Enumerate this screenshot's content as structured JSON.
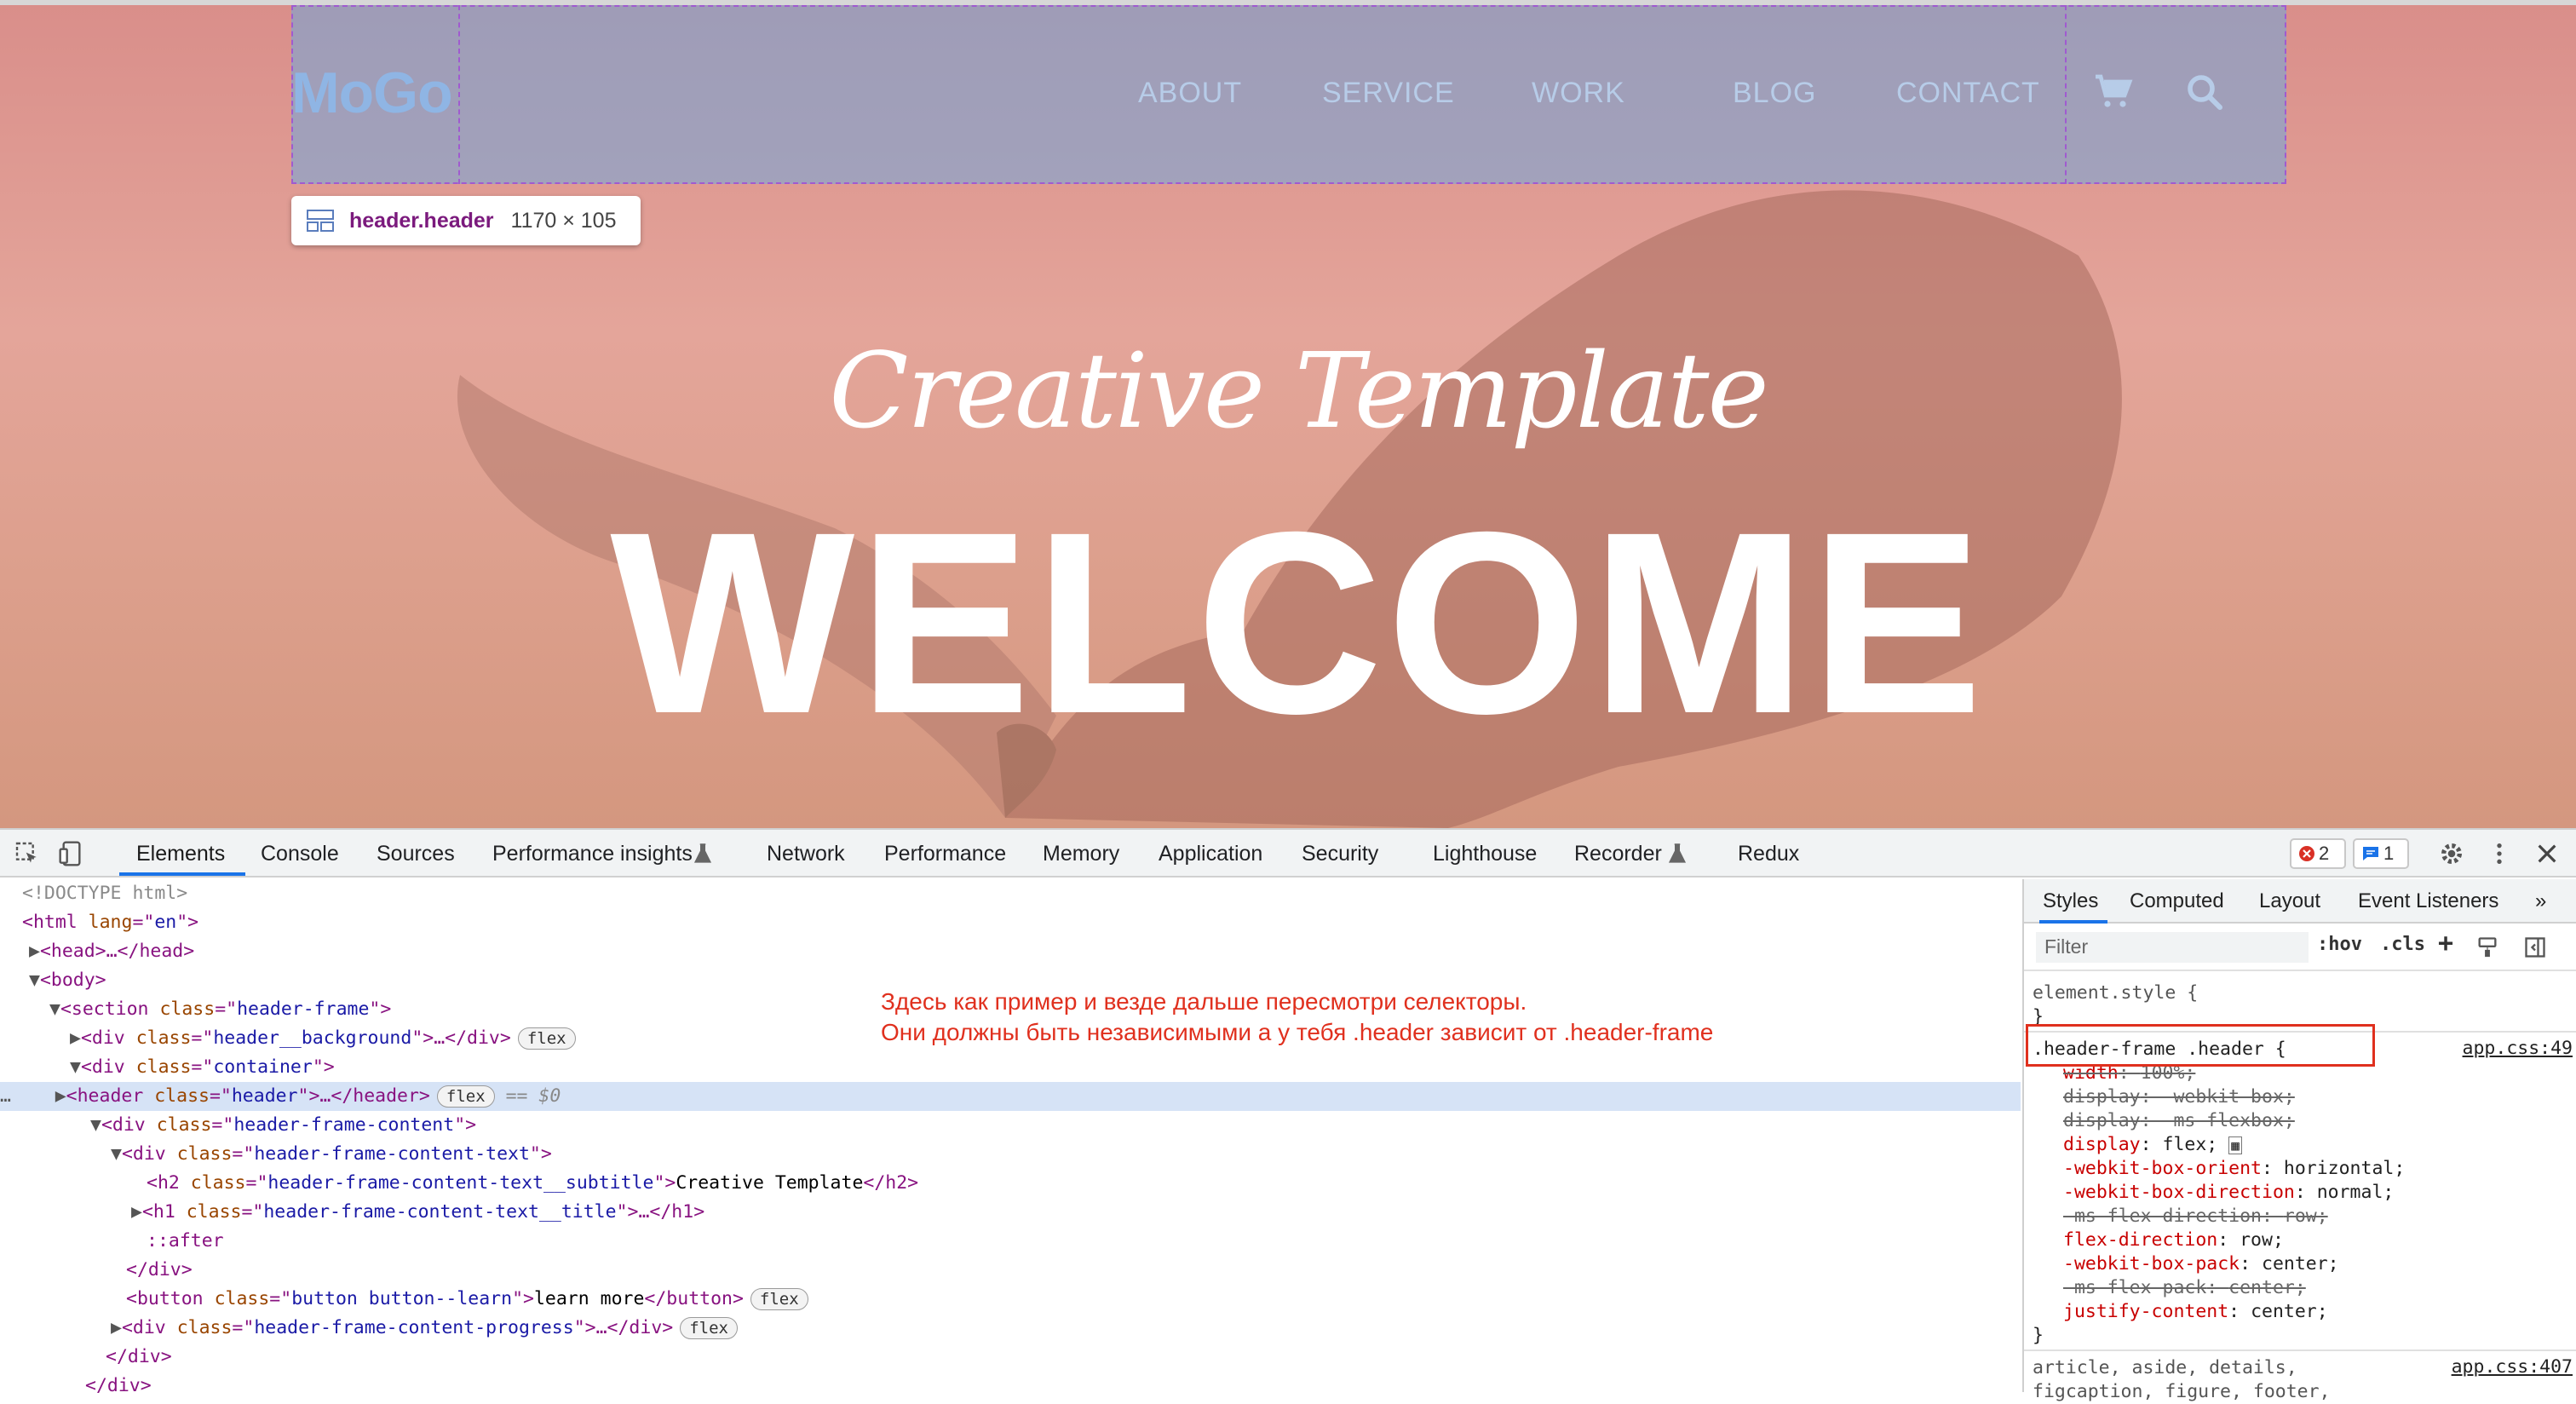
{
  "page": {
    "logo": "MoGo",
    "nav": [
      "ABOUT",
      "SERVICE",
      "WORK",
      "BLOG",
      "CONTACT"
    ],
    "tooltip": {
      "tag": "header.header",
      "size": "1170 × 105"
    },
    "subtitle": "Creative Template",
    "title": "WELCOME"
  },
  "devtools": {
    "tabs": [
      "Elements",
      "Console",
      "Sources",
      "Performance insights",
      "Network",
      "Performance",
      "Memory",
      "Application",
      "Security",
      "Lighthouse",
      "Recorder",
      "Redux"
    ],
    "errors_count": "2",
    "messages_count": "1",
    "dom": {
      "l0": "<!DOCTYPE html>",
      "l1a": "<html ",
      "l1b": "lang",
      "l1c": "=\"",
      "l1d": "en",
      "l1e": "\">",
      "l2": "<head>…</head>",
      "l3": "<body>",
      "l4_tag": "<section ",
      "l4_attr": "class",
      "l4_val": "header-frame",
      "l5_tag": "<div ",
      "l5_attr": "class",
      "l5_val": "header__background",
      "l5_end": ">…</div>",
      "l6_tag": "<div ",
      "l6_attr": "class",
      "l6_val": "container",
      "l7_tag": "<header ",
      "l7_attr": "class",
      "l7_val": "header",
      "l7_end": ">…</header>",
      "l7_dollar": "== $0",
      "l8_tag": "<div ",
      "l8_attr": "class",
      "l8_val": "header-frame-content",
      "l9_tag": "<div ",
      "l9_attr": "class",
      "l9_val": "header-frame-content-text",
      "l10_tag": "<h2 ",
      "l10_attr": "class",
      "l10_val": "header-frame-content-text__subtitle",
      "l10_text": "Creative Template",
      "l10_end": "</h2>",
      "l11_tag": "<h1 ",
      "l11_attr": "class",
      "l11_val": "header-frame-content-text__title",
      "l11_end": ">…</h1>",
      "l12": "::after",
      "l13": "</div>",
      "l14_tag": "<button ",
      "l14_attr": "class",
      "l14_val": "button button--learn",
      "l14_text": "learn more",
      "l14_end": "</button>",
      "l15_tag": "<div ",
      "l15_attr": "class",
      "l15_val": "header-frame-content-progress",
      "l15_end": ">…</div>",
      "l16": "</div>",
      "l17": "</div>",
      "pill": "flex"
    },
    "note_line1": "Здесь как пример и везде дальше пересмотри селекторы.",
    "note_line2": "Они должны быть независимыми а у тебя .header зависит от .header-frame",
    "styles": {
      "tabs": [
        "Styles",
        "Computed",
        "Layout",
        "Event Listeners"
      ],
      "filter_placeholder": "Filter",
      "hov": ":hov",
      "cls": ".cls",
      "element_style": "element.style {",
      "close_brace": "}",
      "selector": ".header-frame .header {",
      "source": "app.css:49",
      "rules": [
        {
          "prop": "width",
          "val": "100%;",
          "struck": true
        },
        {
          "prop": "display",
          "val": "-webkit-box;",
          "struck": true
        },
        {
          "prop": "display",
          "val": "-ms-flexbox;",
          "struck": true
        },
        {
          "prop": "display",
          "val": "flex;",
          "struck": false
        },
        {
          "prop": "-webkit-box-orient",
          "val": "horizontal;",
          "struck": false
        },
        {
          "prop": "-webkit-box-direction",
          "val": "normal;",
          "struck": false
        },
        {
          "prop": "-ms-flex-direction",
          "val": "row;",
          "struck": true
        },
        {
          "prop": "flex-direction",
          "val": "row;",
          "struck": false
        },
        {
          "prop": "-webkit-box-pack",
          "val": "center;",
          "struck": false
        },
        {
          "prop": "-ms-flex-pack",
          "val": "center;",
          "struck": true
        },
        {
          "prop": "justify-content",
          "val": "center;",
          "struck": false
        }
      ],
      "next_selector_1": "article, aside, details,",
      "next_selector_2": "figcaption, figure, footer,",
      "next_source": "app.css:407"
    }
  }
}
